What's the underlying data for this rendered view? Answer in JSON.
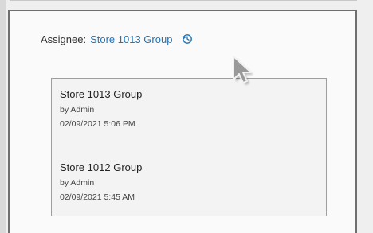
{
  "assignee": {
    "label": "Assignee:",
    "value": "Store 1013 Group",
    "history_icon": "history-icon"
  },
  "history": {
    "entries": [
      {
        "name": "Store 1013 Group",
        "by": "by Admin",
        "date": "02/09/2021 5:06 PM"
      },
      {
        "name": "Store 1012 Group",
        "by": "by Admin",
        "date": "02/09/2021 5:45 AM"
      }
    ]
  },
  "colors": {
    "link": "#1f73b7",
    "panel_border": "#6e6e6e",
    "box_border": "#9e9e9e"
  }
}
